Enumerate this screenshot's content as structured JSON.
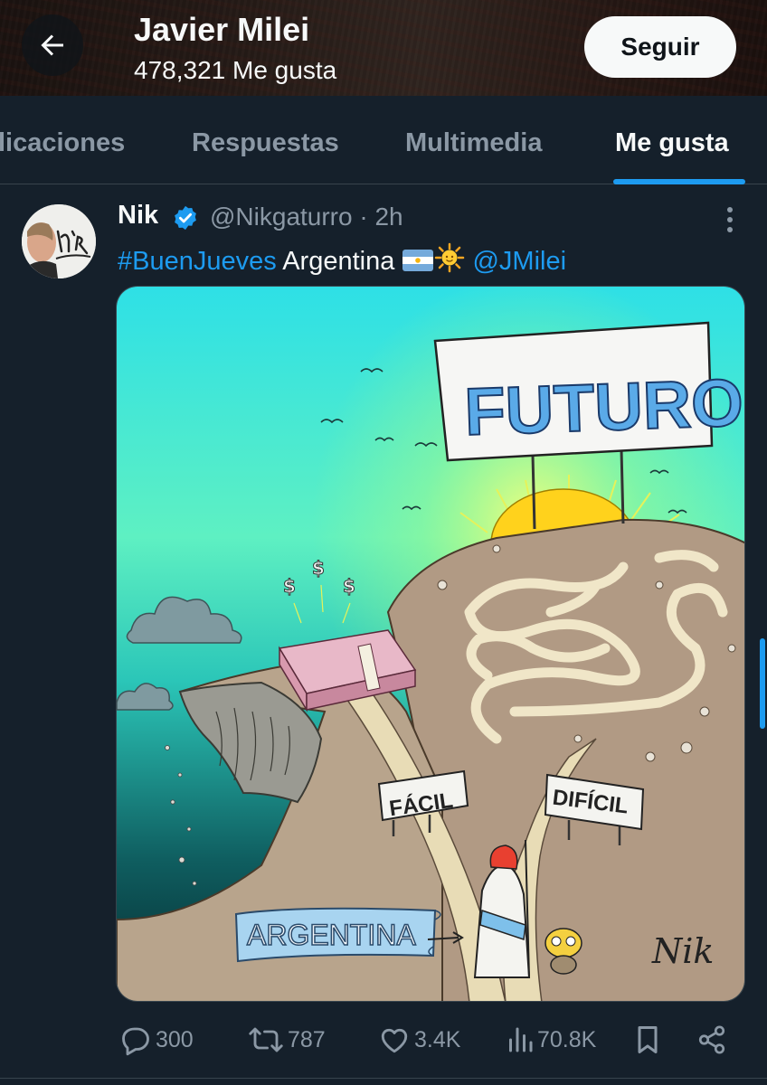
{
  "header": {
    "title": "Javier Milei",
    "subtitle": "478,321 Me gusta",
    "follow_label": "Seguir"
  },
  "tabs": [
    {
      "label": "licaciones",
      "active": false
    },
    {
      "label": "Respuestas",
      "active": false
    },
    {
      "label": "Multimedia",
      "active": false
    },
    {
      "label": "Me gusta",
      "active": true
    }
  ],
  "post": {
    "author_name": "Nik",
    "author_handle": "@Nikgaturro",
    "time": "2h",
    "separator": "·",
    "text_hashtag": "#BuenJueves",
    "text_body": " Argentina ",
    "text_mention": "@JMilei",
    "image": {
      "sign_top": "FUTURO",
      "sign_easy": "FÁCIL",
      "sign_hard": "DIFÍCIL",
      "banner": "ARGENTINA",
      "signature": "Nik"
    }
  },
  "actions": {
    "replies": "300",
    "reposts": "787",
    "likes": "3.4K",
    "views": "70.8K"
  },
  "colors": {
    "background": "#15202b",
    "accent": "#1d9bf0",
    "muted": "#8b98a5",
    "text": "#f7f9f9"
  },
  "icons": [
    "back-arrow-icon",
    "verified-badge-icon",
    "more-options-icon",
    "reply-icon",
    "repost-icon",
    "like-icon",
    "views-icon",
    "bookmark-icon",
    "share-icon",
    "argentina-flag-icon",
    "sun-emoji-icon"
  ]
}
